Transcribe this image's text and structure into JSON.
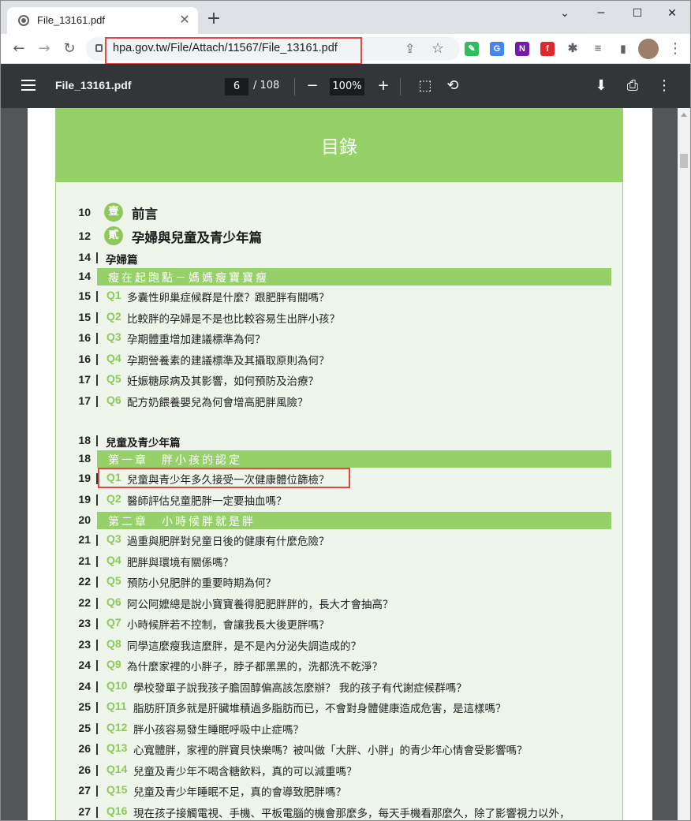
{
  "browser": {
    "tab_title": "File_13161.pdf",
    "tab_close": "✕",
    "new_tab": "+",
    "url": "hpa.gov.tw/File/Attach/11567/File_13161.pdf",
    "window_controls": {
      "collapse": "⌄",
      "minimize": "─",
      "maximize": "☐",
      "close": "✕"
    },
    "nav": {
      "back": "←",
      "forward": "→",
      "reload": "↻"
    },
    "omnibox_icons": {
      "share": "⇪",
      "star": "☆"
    },
    "ext_icons": {
      "evernote": "✎",
      "translate": "G",
      "onenote": "N",
      "flipboard": "f",
      "puzzle": "✱",
      "reading_list": "≡",
      "side_panel": "▮"
    },
    "profile_menu": "⋮"
  },
  "pdf_toolbar": {
    "file_name": "File_13161.pdf",
    "current_page": "6",
    "total_pages": "/ 108",
    "zoom": "100%",
    "zoom_out": "−",
    "zoom_in": "+",
    "fit_icon": "⬚",
    "rotate_icon": "⟲",
    "download_icon": "⬇",
    "print_icon": "⎙",
    "more_icon": "⋮"
  },
  "toc": {
    "heading": "目錄",
    "sections": [
      {
        "page": "10",
        "badge": "壹",
        "label": "前言"
      },
      {
        "page": "12",
        "badge": "貳",
        "label": "孕婦與兒童及青少年篇"
      }
    ],
    "part1": {
      "page": "14",
      "label": "孕婦篇"
    },
    "band1": {
      "page": "14",
      "label": "瘦在起跑點－媽媽瘦寶寶瘦"
    },
    "pregnancy_items": [
      {
        "page": "15",
        "q": "Q1",
        "text": "多囊性卵巢症候群是什麼？跟肥胖有關嗎？"
      },
      {
        "page": "15",
        "q": "Q2",
        "text": "比較胖的孕婦是不是也比較容易生出胖小孩？"
      },
      {
        "page": "16",
        "q": "Q3",
        "text": "孕期體重增加建議標準為何？"
      },
      {
        "page": "16",
        "q": "Q4",
        "text": "孕期營養素的建議標準及其攝取原則為何？"
      },
      {
        "page": "17",
        "q": "Q5",
        "text": "妊娠糖尿病及其影響，如何預防及治療？"
      },
      {
        "page": "17",
        "q": "Q6",
        "text": "配方奶餵養嬰兒為何會增高肥胖風險？"
      }
    ],
    "part2": {
      "page": "18",
      "label": "兒童及青少年篇"
    },
    "chapter1": {
      "page": "18",
      "label": "第一章　胖小孩的認定"
    },
    "chapter1_items": [
      {
        "page": "19",
        "q": "Q1",
        "text": "兒童與青少年多久接受一次健康體位篩檢？"
      },
      {
        "page": "19",
        "q": "Q2",
        "text": "醫師評估兒童肥胖一定要抽血嗎？"
      }
    ],
    "chapter2": {
      "page": "20",
      "label": "第二章　小時候胖就是胖"
    },
    "chapter2_items": [
      {
        "page": "21",
        "q": "Q3",
        "text": "過重與肥胖對兒童日後的健康有什麼危險？"
      },
      {
        "page": "21",
        "q": "Q4",
        "text": "肥胖與環境有關係嗎？"
      },
      {
        "page": "22",
        "q": "Q5",
        "text": "預防小兒肥胖的重要時期為何？"
      },
      {
        "page": "22",
        "q": "Q6",
        "text": "阿公阿嬤總是說小寶寶養得肥肥胖胖的，長大才會抽高？"
      },
      {
        "page": "23",
        "q": "Q7",
        "text": "小時候胖若不控制，會讓我長大後更胖嗎？"
      },
      {
        "page": "23",
        "q": "Q8",
        "text": "同學這麼瘦我這麼胖，是不是內分泌失調造成的？"
      },
      {
        "page": "24",
        "q": "Q9",
        "text": "為什麼家裡的小胖子，脖子都黑黑的，洗都洗不乾淨？"
      },
      {
        "page": "24",
        "q": "Q10",
        "text": "學校發單子說我孩子膽固醇偏高該怎麼辦？ 我的孩子有代謝症候群嗎？"
      },
      {
        "page": "25",
        "q": "Q11",
        "text": "脂肪肝頂多就是肝臟堆積過多脂肪而已，不會對身體健康造成危害，是這樣嗎？"
      },
      {
        "page": "25",
        "q": "Q12",
        "text": "胖小孩容易發生睡眠呼吸中止症嗎？"
      },
      {
        "page": "26",
        "q": "Q13",
        "text": "心寬體胖，家裡的胖寶貝快樂嗎？被叫做「大胖、小胖」的青少年心情會受影響嗎？"
      },
      {
        "page": "26",
        "q": "Q14",
        "text": "兒童及青少年不喝含糖飲料，真的可以減重嗎？"
      },
      {
        "page": "27",
        "q": "Q15",
        "text": "兒童及青少年睡眠不足，真的會導致肥胖嗎？"
      },
      {
        "page": "27",
        "q": "Q16",
        "text": "現在孩子接觸電視、手機、平板電腦的機會那麼多，每天手機看那麼久，除了影響視力以外，"
      }
    ]
  }
}
